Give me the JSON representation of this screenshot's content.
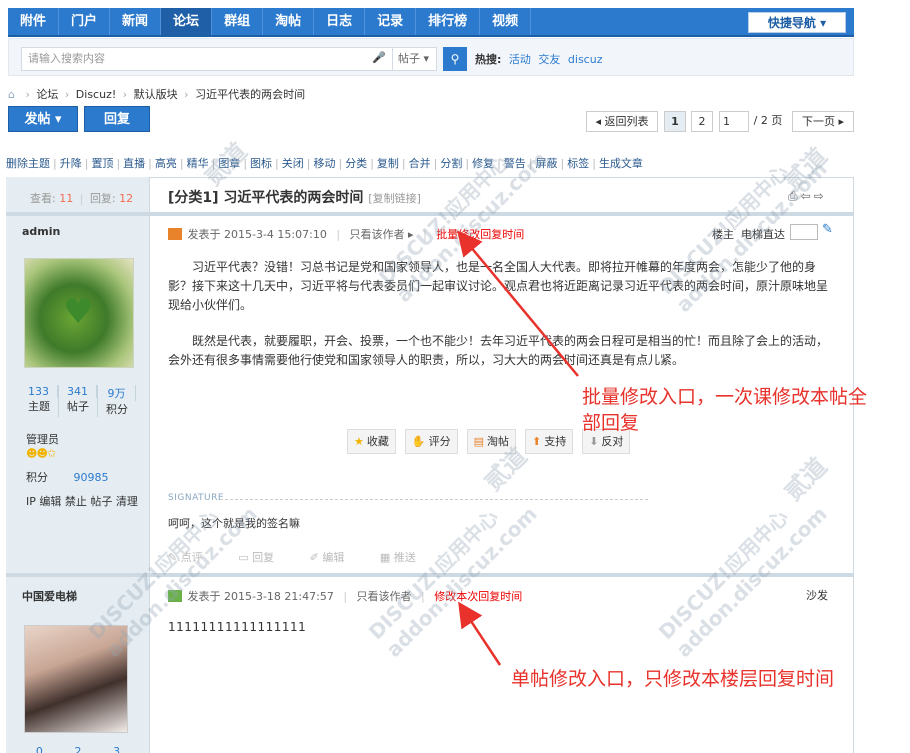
{
  "nav": {
    "items": [
      "附件",
      "门户",
      "新闻",
      "论坛",
      "群组",
      "淘帖",
      "日志",
      "记录",
      "排行榜",
      "视频"
    ],
    "active_index": 3,
    "quick_nav_label": "快捷导航 ▾"
  },
  "search": {
    "placeholder": "请输入搜索内容",
    "scope": "帖子 ▾",
    "hot_label": "热搜:",
    "hot_terms": [
      "活动",
      "交友",
      "discuz"
    ]
  },
  "breadcrumb": [
    "论坛",
    "Discuz!",
    "默认版块",
    "习近平代表的两会时间"
  ],
  "toolbar": {
    "post_label": "发帖 ▾",
    "reply_label": "回复",
    "back_label": "◂ 返回列表",
    "page1": "1",
    "page2": "2",
    "page_input": "1",
    "page_total": "/ 2 页",
    "next_label": "下一页 ▸"
  },
  "mod_actions": [
    "删除主题",
    "升降",
    "置顶",
    "直播",
    "高亮",
    "精华",
    "图章",
    "图标",
    "关闭",
    "移动",
    "分类",
    "复制",
    "合并",
    "分割",
    "修复",
    "警告",
    "屏蔽",
    "标签",
    "生成文章"
  ],
  "thread": {
    "views_label": "查看:",
    "views": "11",
    "replies_label": "回复:",
    "replies": "12",
    "title": "[分类1] 习近平代表的两会时间",
    "copy_link": "[复制链接]"
  },
  "post1": {
    "author": "admin",
    "stats": [
      {
        "value": "133",
        "label": "主题"
      },
      {
        "value": "341",
        "label": "帖子"
      },
      {
        "value": "9万",
        "label": "积分"
      }
    ],
    "group": "管理员",
    "points_label": "积分",
    "points_value": "90985",
    "ip_line": "IP 编辑 禁止 帖子 清理",
    "meta_time": "发表于 2015-3-4 15:07:10",
    "only_author": "只看该作者 ▸",
    "batch_edit": "批量修改回复时间",
    "floor_label": "楼主",
    "jump_label": "电梯直达",
    "para1": "习近平代表？没错！习总书记是党和国家领导人，也是一名全国人大代表。即将拉开帷幕的年度两会，怎能少了他的身影？接下来这十几天中，习近平将与代表委员们一起审议讨论。观点君也将近距离记录习近平代表的两会时间，原汁原味地呈现给小伙伴们。",
    "para2": "既然是代表，就要履职，开会、投票，一个也不能少！去年习近平代表的两会日程可是相当的忙！而且除了会上的活动，会外还有很多事情需要他行使党和国家领导人的职责，所以，习大大的两会时间还真是有点儿紧。",
    "actions": [
      "收藏",
      "评分",
      "淘帖",
      "支持",
      "反对"
    ],
    "sig_label": "SIGNATURE",
    "signature": "呵呵，这个就是我的签名嘛",
    "tools": [
      "点评",
      "回复",
      "编辑",
      "推送"
    ]
  },
  "post2": {
    "author": "中国爱电梯",
    "meta_time": "发表于 2015-3-18 21:47:57",
    "only_author": "只看该作者",
    "single_edit": "修改本次回复时间",
    "floor_label": "沙发",
    "body": "11111111111111111",
    "stats": [
      "0",
      "2",
      "3"
    ]
  },
  "annotations": {
    "batch_line1": "批量修改入口，一次课修改本帖全",
    "batch_line2": "部回复",
    "single": "单帖修改入口，只修改本楼层回复时间"
  },
  "watermark": {
    "line1": "DISCUZ!应用中心",
    "line2": "addon.discuz.com",
    "brand": "贰道"
  },
  "colors": {
    "nav_blue": "#2b7acd",
    "annotation_red": "#e8322b",
    "left_col_bg": "#e5edf2"
  }
}
